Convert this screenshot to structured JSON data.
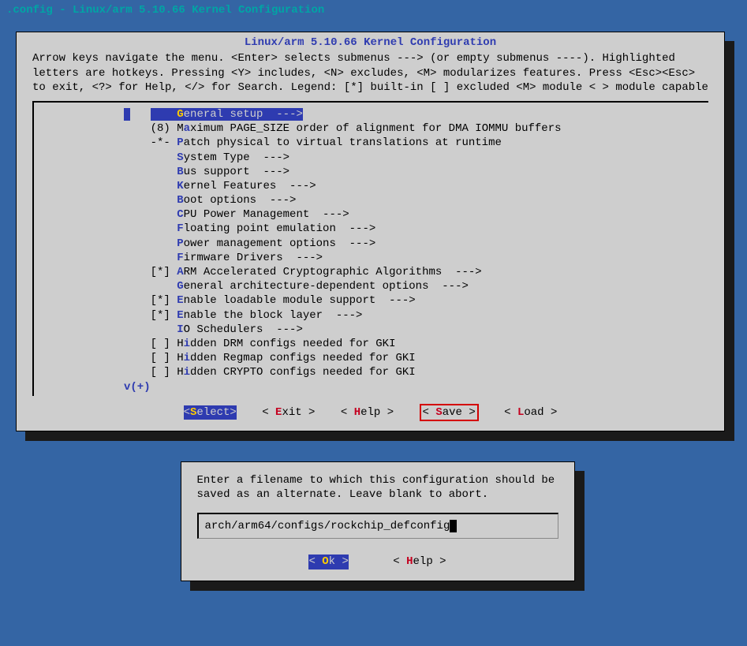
{
  "terminal_title": ".config - Linux/arm 5.10.66 Kernel Configuration",
  "window_title": "Linux/arm 5.10.66 Kernel Configuration",
  "help_lines": "Arrow keys navigate the menu.  <Enter> selects submenus ---> (or empty submenus ----).  Highlighted letters are hotkeys.  Pressing <Y> includes, <N> excludes, <M> modularizes features.  Press <Esc><Esc> to exit, <?> for Help, </> for Search.  Legend: [*] built-in  [ ] excluded  <M> module  < > module capable",
  "menu": [
    {
      "prefix": "    ",
      "hot": "G",
      "rest": "eneral setup  --->",
      "selected": true
    },
    {
      "prefix": "(8) M",
      "hot": "a",
      "rest": "ximum PAGE_SIZE order of alignment for DMA IOMMU buffers"
    },
    {
      "prefix": "-*- ",
      "hot": "P",
      "rest": "atch physical to virtual translations at runtime"
    },
    {
      "prefix": "    ",
      "hot": "S",
      "rest": "ystem Type  --->"
    },
    {
      "prefix": "    ",
      "hot": "B",
      "rest": "us support  --->"
    },
    {
      "prefix": "    ",
      "hot": "K",
      "rest": "ernel Features  --->"
    },
    {
      "prefix": "    ",
      "hot": "B",
      "rest": "oot options  --->"
    },
    {
      "prefix": "    ",
      "hot": "C",
      "rest": "PU Power Management  --->"
    },
    {
      "prefix": "    ",
      "hot": "F",
      "rest": "loating point emulation  --->"
    },
    {
      "prefix": "    ",
      "hot": "P",
      "rest": "ower management options  --->"
    },
    {
      "prefix": "    ",
      "hot": "F",
      "rest": "irmware Drivers  --->"
    },
    {
      "prefix": "[*] ",
      "hot": "A",
      "rest": "RM Accelerated Cryptographic Algorithms  --->"
    },
    {
      "prefix": "    ",
      "hot": "G",
      "rest": "eneral architecture-dependent options  --->"
    },
    {
      "prefix": "[*] ",
      "hot": "E",
      "rest": "nable loadable module support  --->"
    },
    {
      "prefix": "[*] ",
      "hot": "E",
      "rest": "nable the block layer  --->"
    },
    {
      "prefix": "    ",
      "hot": "I",
      "rest": "O Schedulers  --->"
    },
    {
      "prefix": "[ ] H",
      "hot": "i",
      "rest": "dden DRM configs needed for GKI"
    },
    {
      "prefix": "[ ] H",
      "hot": "i",
      "rest": "dden Regmap configs needed for GKI"
    },
    {
      "prefix": "[ ] H",
      "hot": "i",
      "rest": "dden CRYPTO configs needed for GKI"
    }
  ],
  "scroll_indicator": "v(+)",
  "buttons": {
    "select": {
      "pre": "<",
      "hk": "S",
      "post": "elect>"
    },
    "exit": {
      "pre": "< ",
      "hk": "E",
      "post": "xit >"
    },
    "help": {
      "pre": "< ",
      "hk": "H",
      "post": "elp >"
    },
    "save": {
      "pre": "< ",
      "hk": "S",
      "post": "ave >"
    },
    "load": {
      "pre": "< ",
      "hk": "L",
      "post": "oad >"
    }
  },
  "dialog": {
    "text": "Enter a filename to which this configuration should be saved as an alternate.  Leave blank to abort.",
    "input": "arch/arm64/configs/rockchip_defconfig",
    "ok": {
      "pre": "<  ",
      "hk": "O",
      "post": "k  >"
    },
    "help": {
      "pre": "< ",
      "hk": "H",
      "post": "elp >"
    }
  }
}
